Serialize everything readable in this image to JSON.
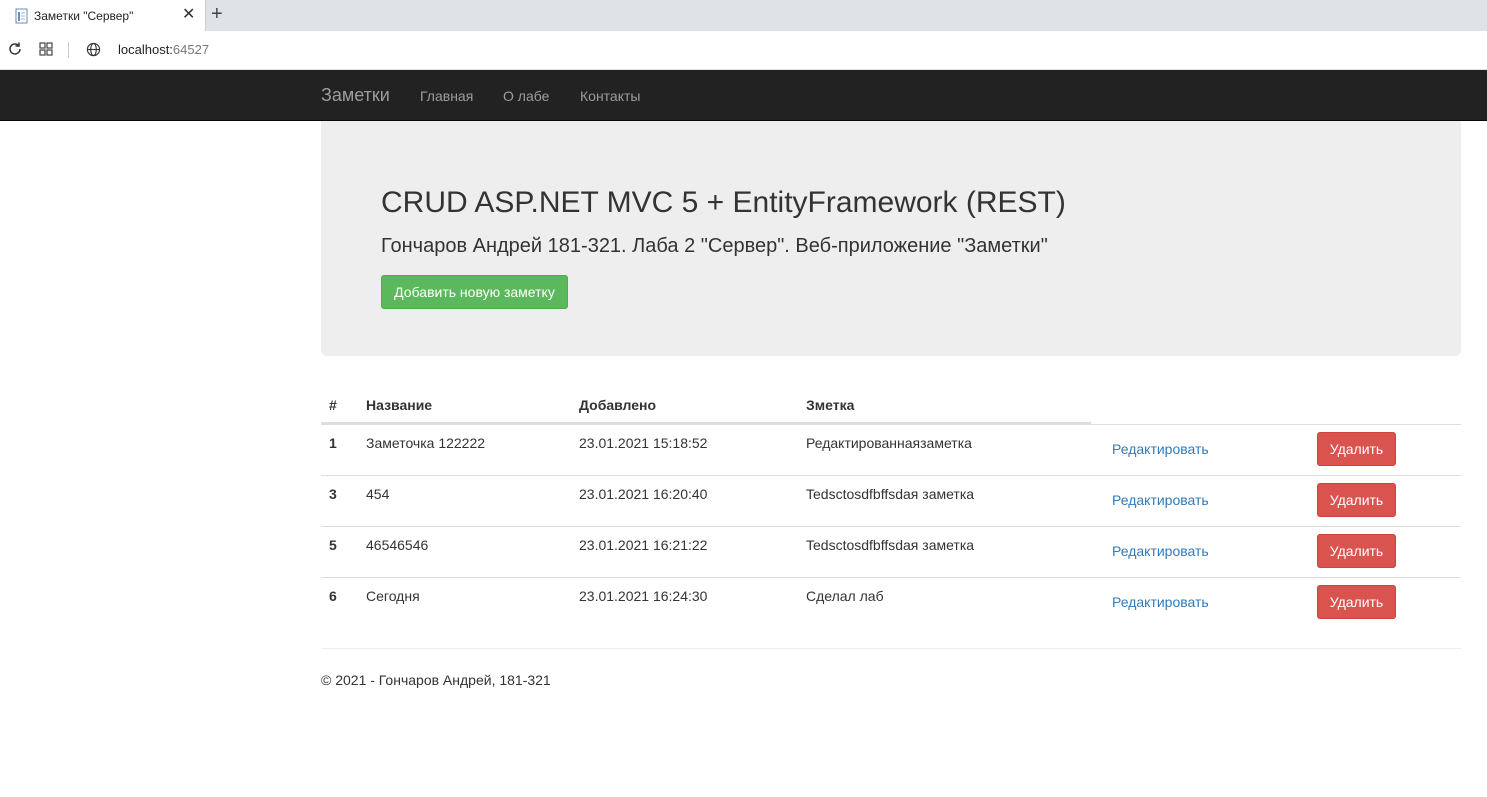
{
  "browser": {
    "tab_title": "Заметки \"Сервер\"",
    "url_host": "localhost:",
    "url_port": "64527"
  },
  "navbar": {
    "brand": "Заметки",
    "links": [
      "Главная",
      "О лабе",
      "Контакты"
    ]
  },
  "jumbotron": {
    "title": "CRUD ASP.NET MVC 5 + EntityFramework (REST)",
    "subtitle": "Гончаров Андрей 181-321. Лаба 2 \"Сервер\". Веб-приложение \"Заметки\"",
    "add_button": "Добавить новую заметку"
  },
  "table": {
    "headers": [
      "#",
      "Название",
      "Добавлено",
      "Зметка"
    ],
    "rows": [
      {
        "id": "1",
        "name": "Заметочка 122222",
        "added": "23.01.2021 15:18:52",
        "note": "Редактированнаязаметка"
      },
      {
        "id": "3",
        "name": "454",
        "added": "23.01.2021 16:20:40",
        "note": "Tedsctosdfbffsdaя заметка"
      },
      {
        "id": "5",
        "name": "46546546",
        "added": "23.01.2021 16:21:22",
        "note": "Tedsctosdfbffsdaя заметка"
      },
      {
        "id": "6",
        "name": "Сегодня",
        "added": "23.01.2021 16:24:30",
        "note": "Сделал лаб"
      }
    ],
    "edit_label": "Редактировать",
    "delete_label": "Удалить"
  },
  "footer": {
    "text": "© 2021 - Гончаров Андрей, 181-321"
  },
  "colors": {
    "navbar_bg": "#222222",
    "jumbotron_bg": "#eeeeee",
    "success": "#5cb85c",
    "danger": "#d9534f",
    "link": "#337ab7"
  }
}
